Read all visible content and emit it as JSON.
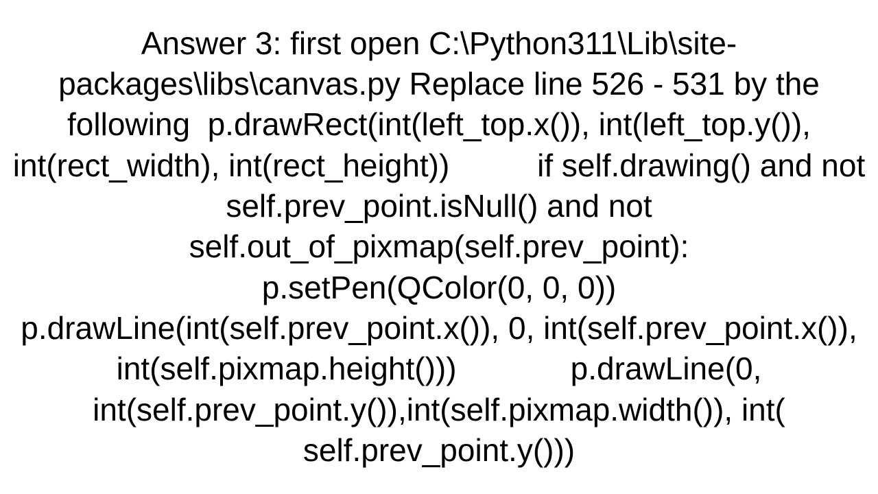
{
  "answer": {
    "text": "Answer 3: first open C:\\Python311\\Lib\\site-packages\\libs\\canvas.py Replace line 526 - 531 by the following  p.drawRect(int(left_top.x()), int(left_top.y()), int(rect_width), int(rect_height))          if self.drawing() and not self.prev_point.isNull() and not self.out_of_pixmap(self.prev_point):             p.setPen(QColor(0, 0, 0))             p.drawLine(int(self.prev_point.x()), 0, int(self.prev_point.x()), int(self.pixmap.height()))             p.drawLine(0, int(self.prev_point.y()),int(self.pixmap.width()), int( self.prev_point.y()))"
  }
}
